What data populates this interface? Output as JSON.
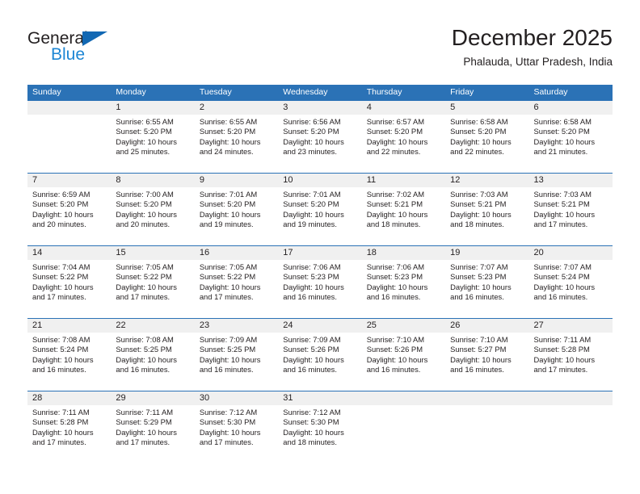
{
  "brand": {
    "name_part1": "General",
    "name_part2": "Blue"
  },
  "header": {
    "title": "December 2025",
    "subtitle": "Phalauda, Uttar Pradesh, India"
  },
  "colors": {
    "header_blue": "#2b72b6",
    "logo_blue": "#1d86d4",
    "day_band_gray": "#f0f0f0",
    "text": "#231f20"
  },
  "weekdays": [
    "Sunday",
    "Monday",
    "Tuesday",
    "Wednesday",
    "Thursday",
    "Friday",
    "Saturday"
  ],
  "weeks": [
    [
      {
        "day": "",
        "sunrise": "",
        "sunset": "",
        "daylight1": "",
        "daylight2": ""
      },
      {
        "day": "1",
        "sunrise": "Sunrise: 6:55 AM",
        "sunset": "Sunset: 5:20 PM",
        "daylight1": "Daylight: 10 hours",
        "daylight2": "and 25 minutes."
      },
      {
        "day": "2",
        "sunrise": "Sunrise: 6:55 AM",
        "sunset": "Sunset: 5:20 PM",
        "daylight1": "Daylight: 10 hours",
        "daylight2": "and 24 minutes."
      },
      {
        "day": "3",
        "sunrise": "Sunrise: 6:56 AM",
        "sunset": "Sunset: 5:20 PM",
        "daylight1": "Daylight: 10 hours",
        "daylight2": "and 23 minutes."
      },
      {
        "day": "4",
        "sunrise": "Sunrise: 6:57 AM",
        "sunset": "Sunset: 5:20 PM",
        "daylight1": "Daylight: 10 hours",
        "daylight2": "and 22 minutes."
      },
      {
        "day": "5",
        "sunrise": "Sunrise: 6:58 AM",
        "sunset": "Sunset: 5:20 PM",
        "daylight1": "Daylight: 10 hours",
        "daylight2": "and 22 minutes."
      },
      {
        "day": "6",
        "sunrise": "Sunrise: 6:58 AM",
        "sunset": "Sunset: 5:20 PM",
        "daylight1": "Daylight: 10 hours",
        "daylight2": "and 21 minutes."
      }
    ],
    [
      {
        "day": "7",
        "sunrise": "Sunrise: 6:59 AM",
        "sunset": "Sunset: 5:20 PM",
        "daylight1": "Daylight: 10 hours",
        "daylight2": "and 20 minutes."
      },
      {
        "day": "8",
        "sunrise": "Sunrise: 7:00 AM",
        "sunset": "Sunset: 5:20 PM",
        "daylight1": "Daylight: 10 hours",
        "daylight2": "and 20 minutes."
      },
      {
        "day": "9",
        "sunrise": "Sunrise: 7:01 AM",
        "sunset": "Sunset: 5:20 PM",
        "daylight1": "Daylight: 10 hours",
        "daylight2": "and 19 minutes."
      },
      {
        "day": "10",
        "sunrise": "Sunrise: 7:01 AM",
        "sunset": "Sunset: 5:20 PM",
        "daylight1": "Daylight: 10 hours",
        "daylight2": "and 19 minutes."
      },
      {
        "day": "11",
        "sunrise": "Sunrise: 7:02 AM",
        "sunset": "Sunset: 5:21 PM",
        "daylight1": "Daylight: 10 hours",
        "daylight2": "and 18 minutes."
      },
      {
        "day": "12",
        "sunrise": "Sunrise: 7:03 AM",
        "sunset": "Sunset: 5:21 PM",
        "daylight1": "Daylight: 10 hours",
        "daylight2": "and 18 minutes."
      },
      {
        "day": "13",
        "sunrise": "Sunrise: 7:03 AM",
        "sunset": "Sunset: 5:21 PM",
        "daylight1": "Daylight: 10 hours",
        "daylight2": "and 17 minutes."
      }
    ],
    [
      {
        "day": "14",
        "sunrise": "Sunrise: 7:04 AM",
        "sunset": "Sunset: 5:22 PM",
        "daylight1": "Daylight: 10 hours",
        "daylight2": "and 17 minutes."
      },
      {
        "day": "15",
        "sunrise": "Sunrise: 7:05 AM",
        "sunset": "Sunset: 5:22 PM",
        "daylight1": "Daylight: 10 hours",
        "daylight2": "and 17 minutes."
      },
      {
        "day": "16",
        "sunrise": "Sunrise: 7:05 AM",
        "sunset": "Sunset: 5:22 PM",
        "daylight1": "Daylight: 10 hours",
        "daylight2": "and 17 minutes."
      },
      {
        "day": "17",
        "sunrise": "Sunrise: 7:06 AM",
        "sunset": "Sunset: 5:23 PM",
        "daylight1": "Daylight: 10 hours",
        "daylight2": "and 16 minutes."
      },
      {
        "day": "18",
        "sunrise": "Sunrise: 7:06 AM",
        "sunset": "Sunset: 5:23 PM",
        "daylight1": "Daylight: 10 hours",
        "daylight2": "and 16 minutes."
      },
      {
        "day": "19",
        "sunrise": "Sunrise: 7:07 AM",
        "sunset": "Sunset: 5:23 PM",
        "daylight1": "Daylight: 10 hours",
        "daylight2": "and 16 minutes."
      },
      {
        "day": "20",
        "sunrise": "Sunrise: 7:07 AM",
        "sunset": "Sunset: 5:24 PM",
        "daylight1": "Daylight: 10 hours",
        "daylight2": "and 16 minutes."
      }
    ],
    [
      {
        "day": "21",
        "sunrise": "Sunrise: 7:08 AM",
        "sunset": "Sunset: 5:24 PM",
        "daylight1": "Daylight: 10 hours",
        "daylight2": "and 16 minutes."
      },
      {
        "day": "22",
        "sunrise": "Sunrise: 7:08 AM",
        "sunset": "Sunset: 5:25 PM",
        "daylight1": "Daylight: 10 hours",
        "daylight2": "and 16 minutes."
      },
      {
        "day": "23",
        "sunrise": "Sunrise: 7:09 AM",
        "sunset": "Sunset: 5:25 PM",
        "daylight1": "Daylight: 10 hours",
        "daylight2": "and 16 minutes."
      },
      {
        "day": "24",
        "sunrise": "Sunrise: 7:09 AM",
        "sunset": "Sunset: 5:26 PM",
        "daylight1": "Daylight: 10 hours",
        "daylight2": "and 16 minutes."
      },
      {
        "day": "25",
        "sunrise": "Sunrise: 7:10 AM",
        "sunset": "Sunset: 5:26 PM",
        "daylight1": "Daylight: 10 hours",
        "daylight2": "and 16 minutes."
      },
      {
        "day": "26",
        "sunrise": "Sunrise: 7:10 AM",
        "sunset": "Sunset: 5:27 PM",
        "daylight1": "Daylight: 10 hours",
        "daylight2": "and 16 minutes."
      },
      {
        "day": "27",
        "sunrise": "Sunrise: 7:11 AM",
        "sunset": "Sunset: 5:28 PM",
        "daylight1": "Daylight: 10 hours",
        "daylight2": "and 17 minutes."
      }
    ],
    [
      {
        "day": "28",
        "sunrise": "Sunrise: 7:11 AM",
        "sunset": "Sunset: 5:28 PM",
        "daylight1": "Daylight: 10 hours",
        "daylight2": "and 17 minutes."
      },
      {
        "day": "29",
        "sunrise": "Sunrise: 7:11 AM",
        "sunset": "Sunset: 5:29 PM",
        "daylight1": "Daylight: 10 hours",
        "daylight2": "and 17 minutes."
      },
      {
        "day": "30",
        "sunrise": "Sunrise: 7:12 AM",
        "sunset": "Sunset: 5:30 PM",
        "daylight1": "Daylight: 10 hours",
        "daylight2": "and 17 minutes."
      },
      {
        "day": "31",
        "sunrise": "Sunrise: 7:12 AM",
        "sunset": "Sunset: 5:30 PM",
        "daylight1": "Daylight: 10 hours",
        "daylight2": "and 18 minutes."
      },
      {
        "day": "",
        "sunrise": "",
        "sunset": "",
        "daylight1": "",
        "daylight2": ""
      },
      {
        "day": "",
        "sunrise": "",
        "sunset": "",
        "daylight1": "",
        "daylight2": ""
      },
      {
        "day": "",
        "sunrise": "",
        "sunset": "",
        "daylight1": "",
        "daylight2": ""
      }
    ]
  ]
}
